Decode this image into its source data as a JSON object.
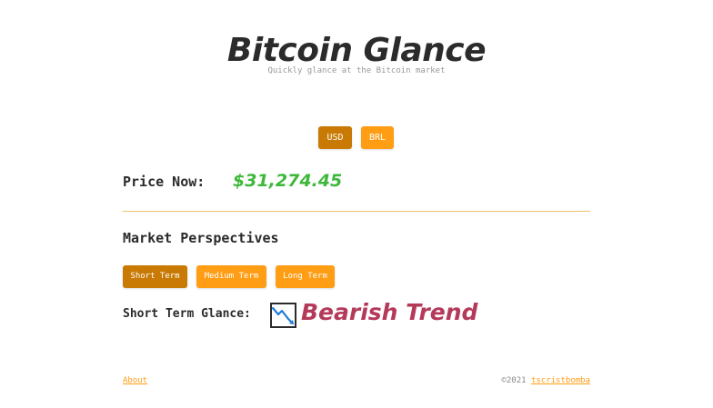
{
  "header": {
    "title": "Bitcoin Glance",
    "subtitle": "Quickly glance at the Bitcoin market"
  },
  "currency": {
    "buttons": [
      {
        "label": "USD",
        "active": true
      },
      {
        "label": "BRL",
        "active": false
      }
    ]
  },
  "price": {
    "label": "Price Now:",
    "value": "$31,274.45"
  },
  "perspectives": {
    "title": "Market Perspectives",
    "buttons": [
      {
        "label": "Short Term",
        "active": true
      },
      {
        "label": "Medium Term",
        "active": false
      },
      {
        "label": "Long Term",
        "active": false
      }
    ],
    "glance_label": "Short Term Glance:",
    "trend_icon": "chart-downtrend-icon",
    "trend_text": "Bearish Trend"
  },
  "footer": {
    "about_label": "About",
    "copyright": "©2021",
    "author": "tscristbomba"
  },
  "colors": {
    "accent": "#ff9d14",
    "accent_active": "#c87a04",
    "price_green": "#3db83a",
    "bearish": "#b43a5a",
    "divider": "#efc171"
  }
}
